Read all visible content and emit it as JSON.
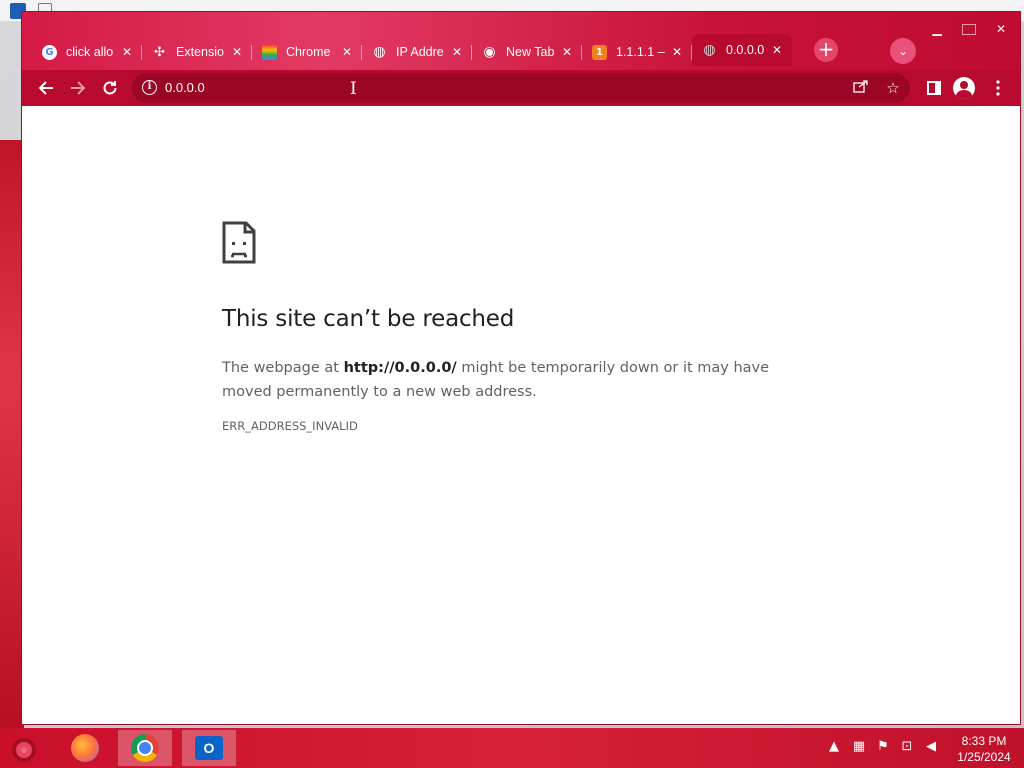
{
  "browser": {
    "tabs": [
      {
        "title": "click allo",
        "favicon": "google-icon",
        "fav_color": "#4285f4",
        "fav_glyph": "G"
      },
      {
        "title": "Extensio",
        "favicon": "puzzle-icon",
        "fav_color": "#ffffff",
        "fav_glyph": "✣"
      },
      {
        "title": "Chrome",
        "favicon": "rainbow-icon",
        "fav_color": "#f4b400",
        "fav_glyph": "≈"
      },
      {
        "title": "IP Addre",
        "favicon": "globe-icon",
        "fav_color": "#ffffff",
        "fav_glyph": "◍"
      },
      {
        "title": "New Tab",
        "favicon": "chrome-icon",
        "fav_color": "#ffffff",
        "fav_glyph": "◉"
      },
      {
        "title": "1.1.1.1 –",
        "favicon": "cloudflare-1111-icon",
        "fav_color": "#f38020",
        "fav_glyph": "1"
      },
      {
        "title": "0.0.0.0",
        "favicon": "globe-icon",
        "fav_color": "#d9d9d9",
        "fav_glyph": "◍",
        "active": true
      }
    ],
    "close_glyph": "✕",
    "new_tab_glyph": "+",
    "tab_search_glyph": "⌄",
    "address": "0.0.0.0",
    "accent": "#b80a2e"
  },
  "error_page": {
    "title": "This site can’t be reached",
    "body_prefix": "The webpage at ",
    "body_url": "http://0.0.0.0/",
    "body_suffix": " might be temporarily down or it may have moved permanently to a new web address.",
    "code": "ERR_ADDRESS_INVALID"
  },
  "taskbar": {
    "apps": [
      "firefox-icon",
      "chrome-icon",
      "outlook-icon"
    ],
    "outlook_letter": "O",
    "time": "8:33 PM",
    "date": "1/25/2024"
  }
}
